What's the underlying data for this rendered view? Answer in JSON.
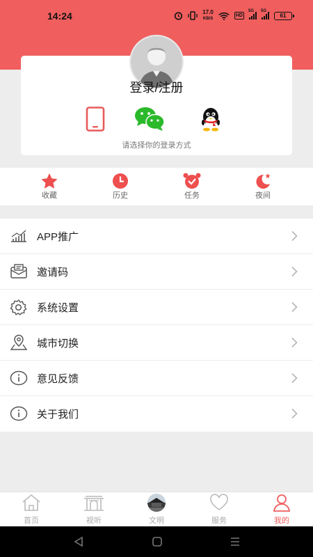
{
  "status_bar": {
    "time": "14:24",
    "speed_value": "17.0",
    "speed_unit": "KB/S",
    "hd": "HD",
    "net1": "5G",
    "net2": "5G",
    "battery": "61"
  },
  "login": {
    "title": "登录/注册",
    "hint": "请选择你的登录方式",
    "methods": [
      "phone-icon",
      "wechat-icon",
      "qq-icon"
    ]
  },
  "quick_actions": [
    {
      "label": "收藏",
      "icon": "star-icon"
    },
    {
      "label": "历史",
      "icon": "clock-icon"
    },
    {
      "label": "任务",
      "icon": "alarm-icon"
    },
    {
      "label": "夜间",
      "icon": "moon-icon"
    }
  ],
  "menu": [
    {
      "label": "APP推广",
      "icon": "chart-icon"
    },
    {
      "label": "邀请码",
      "icon": "envelope-icon"
    },
    {
      "label": "系统设置",
      "icon": "gear-icon"
    },
    {
      "label": "城市切换",
      "icon": "location-icon"
    },
    {
      "label": "意见反馈",
      "icon": "info-icon"
    },
    {
      "label": "关于我们",
      "icon": "info-icon"
    }
  ],
  "tabs": [
    {
      "label": "首页",
      "icon": "home-icon"
    },
    {
      "label": "视听",
      "icon": "gate-icon"
    },
    {
      "label": "文明",
      "icon": "photo-icon"
    },
    {
      "label": "服务",
      "icon": "heart-icon"
    },
    {
      "label": "我的",
      "icon": "user-icon",
      "active": true
    }
  ],
  "colors": {
    "accent": "#f05e5e",
    "wechat": "#2bb92b",
    "page_bg": "#ededed"
  }
}
